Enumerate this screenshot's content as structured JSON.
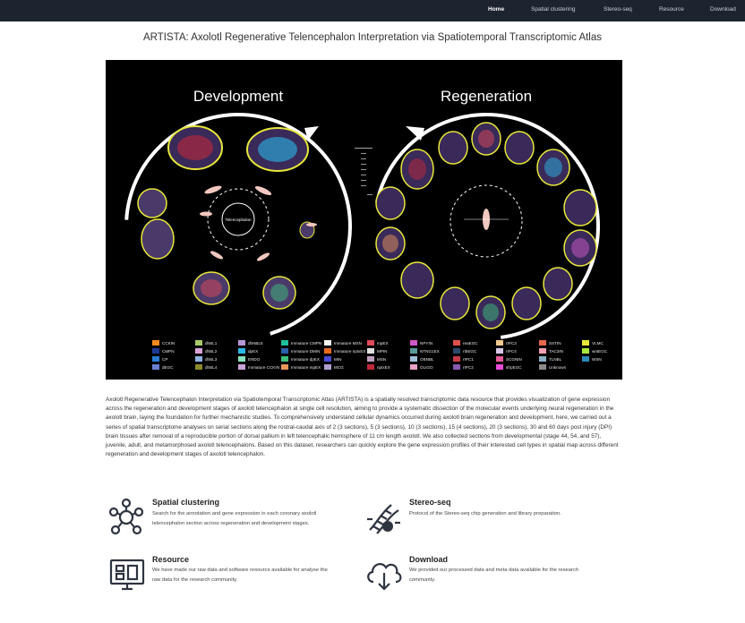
{
  "nav": {
    "items": [
      {
        "label": "Home",
        "active": true
      },
      {
        "label": "Spatial clustering",
        "active": false
      },
      {
        "label": "Stereo-seq",
        "active": false
      },
      {
        "label": "Resource",
        "active": false
      },
      {
        "label": "Download",
        "active": false
      }
    ]
  },
  "page_title": "ARTISTA: Axolotl Regenerative Telencephalon Interpretation via Spatiotemporal Transcriptomic Atlas",
  "figure": {
    "development_label": "Development",
    "regeneration_label": "Regeneration",
    "center_label": "Telencephalon",
    "legend": [
      {
        "label": "CCKIN",
        "color": "#f28c1e"
      },
      {
        "label": "CMPN",
        "color": "#1f3a93"
      },
      {
        "label": "CP",
        "color": "#2a7bd4"
      },
      {
        "label": "dEGC",
        "color": "#6b7fd1"
      },
      {
        "label": "dhBL1",
        "color": "#a8c96a"
      },
      {
        "label": "dhBL2",
        "color": "#d8a2d8"
      },
      {
        "label": "dhBL3",
        "color": "#8fb3e0"
      },
      {
        "label": "dhBL4",
        "color": "#8a8a2a"
      },
      {
        "label": "dhNBL5",
        "color": "#b897d6"
      },
      {
        "label": "dpEX",
        "color": "#2ab7e6"
      },
      {
        "label": "ENDO",
        "color": "#8be0c0"
      },
      {
        "label": "Immature CCKIN",
        "color": "#c9a3d9"
      },
      {
        "label": "Immature CMPN",
        "color": "#1fbf9a"
      },
      {
        "label": "Immature DMIN",
        "color": "#2b5fa8"
      },
      {
        "label": "Immature dpEX",
        "color": "#3dbf7a"
      },
      {
        "label": "Immature mpEX",
        "color": "#e8965a"
      },
      {
        "label": "Immature MSN",
        "color": "#f5f5f0"
      },
      {
        "label": "Immature nptxEX",
        "color": "#e86a1a"
      },
      {
        "label": "MIN",
        "color": "#4a4ad6"
      },
      {
        "label": "MCG",
        "color": "#b0a0d0"
      },
      {
        "label": "mpEX",
        "color": "#e04a5a"
      },
      {
        "label": "MPIN",
        "color": "#e0e0e0"
      },
      {
        "label": "MSN",
        "color": "#c0a0c0"
      },
      {
        "label": "nptxEX",
        "color": "#c0283a"
      },
      {
        "label": "NPYIN",
        "color": "#d05ac8"
      },
      {
        "label": "NTNG1EX",
        "color": "#5a9a9a"
      },
      {
        "label": "OBNBL",
        "color": "#a0c0d8"
      },
      {
        "label": "OLIGO",
        "color": "#e8a0c8"
      },
      {
        "label": "reaEGC",
        "color": "#e0504a"
      },
      {
        "label": "rIbEGC",
        "color": "#2a4a6a"
      },
      {
        "label": "rIPC1",
        "color": "#c83a4a"
      },
      {
        "label": "rIPC2",
        "color": "#8a5ab0"
      },
      {
        "label": "rIPC3",
        "color": "#f0c890"
      },
      {
        "label": "rIPC4",
        "color": "#d8c8e8"
      },
      {
        "label": "SCGNIN",
        "color": "#e85a9a"
      },
      {
        "label": "sfrpEGC",
        "color": "#e84ad8"
      },
      {
        "label": "SSTIN",
        "color": "#e8684a"
      },
      {
        "label": "TAC3IN",
        "color": "#f0a0b0"
      },
      {
        "label": "TLNBL",
        "color": "#8ab0c8"
      },
      {
        "label": "Unknown",
        "color": "#8a8a8a"
      },
      {
        "label": "VLMC",
        "color": "#e8e83a"
      },
      {
        "label": "wntEGC",
        "color": "#a8e83a"
      },
      {
        "label": "WSN",
        "color": "#2a8ab8"
      }
    ]
  },
  "description": "Axolotl Regenerative Telencephalon Interpretation via Spatiotemporal Transcriptomic Atlas (ARTISTA) is a spatially resolved transcriptomic data resource that provides visualization of gene expression across the regeneration and development stages of axolotl telencephalon at single cell resolution, aiming to provide a systematic dissection of the molecular events underlying neural regeneration in the axolotl brain, laying the foundation for further mechanistic studies. To comprehensively understand cellular dynamics occurred during axolotl brain regeneration and development, here, we carried out a series of spatial transcriptome analyses on serial sections along the rostral-caudal axis of 2 (3 sections), 5 (3 sections), 10 (3 sections), 15 (4 sections), 20 (3 sections), 30 and 60 days post injury (DPI) brain tissues after removal of a reproducible portion of dorsal pallium in left telencephalic hemisphere of 11 cm length axolotl. We also collected sections from developmental (stage 44, 54, and 57), juvenile, adult, and metamorphosed axolotl telencephalons. Based on this dataset, researchers can quickly explore the gene expression profiles of their interested cell types in spatial map across different regeneration and development stages of axolotl telencephalon.",
  "features": [
    {
      "title": "Spatial clustering",
      "desc": "Search for the annotation and gene expression in each coronary axolotl telencephalon section across regeneration and development stages.",
      "icon": "cluster-icon"
    },
    {
      "title": "Stereo-seq",
      "desc": "Protocol of the Stereo-seq chip generation and library preparation.",
      "icon": "dna-icon"
    },
    {
      "title": "Resource",
      "desc": "We have made our raw data and software resource available for analyse the raw data for the research community.",
      "icon": "monitor-icon"
    },
    {
      "title": "Download",
      "desc": "We provided our processed data and meta data available for the research community.",
      "icon": "cloud-download-icon"
    }
  ]
}
